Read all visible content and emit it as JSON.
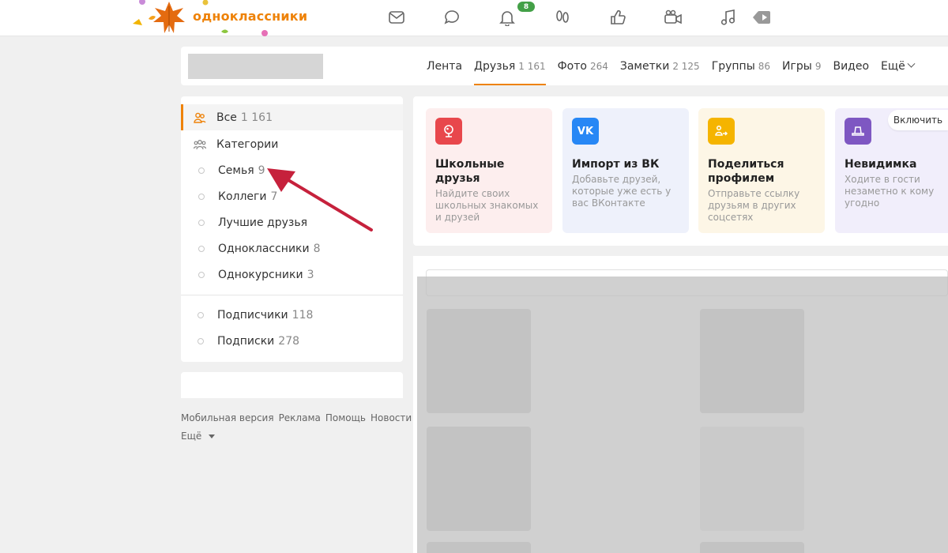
{
  "header": {
    "logo_text": "одноклассники",
    "notifications_count": "8",
    "icons": [
      "messages-icon",
      "discussions-icon",
      "notifications-icon",
      "guests-icon",
      "likes-icon",
      "video-icon",
      "music-icon",
      "tv-icon"
    ]
  },
  "profile_tabs": [
    {
      "label": "Лента",
      "count": ""
    },
    {
      "label": "Друзья",
      "count": "1 161",
      "active": true
    },
    {
      "label": "Фото",
      "count": "264"
    },
    {
      "label": "Заметки",
      "count": "2 125"
    },
    {
      "label": "Группы",
      "count": "86"
    },
    {
      "label": "Игры",
      "count": "9"
    },
    {
      "label": "Видео",
      "count": ""
    },
    {
      "label": "Ещё",
      "count": ""
    }
  ],
  "left_menu": {
    "all": {
      "label": "Все",
      "count": "1 161"
    },
    "categories": {
      "label": "Категории"
    },
    "items": [
      {
        "label": "Семья",
        "count": "9"
      },
      {
        "label": "Коллеги",
        "count": "7"
      },
      {
        "label": "Лучшие друзья",
        "count": ""
      },
      {
        "label": "Одноклассники",
        "count": "8"
      },
      {
        "label": "Однокурсники",
        "count": "3"
      }
    ],
    "subscribers": {
      "label": "Подписчики",
      "count": "118"
    },
    "subscriptions": {
      "label": "Подписки",
      "count": "278"
    }
  },
  "footer": {
    "links": [
      "Мобильная версия",
      "Реклама",
      "Помощь",
      "Новости"
    ],
    "more": "Ещё"
  },
  "cards": [
    {
      "title": "Школьные друзья",
      "desc": "Найдите своих школьных знакомых и друзей",
      "bg": "#fdeeee",
      "icon_bg": "#e8474c",
      "icon": "school-icon"
    },
    {
      "title": "Импорт из ВК",
      "desc": "Добавьте друзей, которые уже есть у вас ВКонтакте",
      "bg": "#eef1fb",
      "icon_bg": "#2787f5",
      "icon": "vk-icon"
    },
    {
      "title": "Поделиться профилем",
      "desc": "Отправьте ссылку друзьям в других соцсетях",
      "bg": "#fdf6e6",
      "icon_bg": "#f5b400",
      "icon": "share-icon"
    },
    {
      "title": "Невидимка",
      "desc": "Ходите в гости незаметно к кому угодно",
      "bg": "#f1eefb",
      "icon_bg": "#7e57c2",
      "icon": "invisible-icon"
    }
  ],
  "enable_button": "Включить",
  "colors": {
    "accent": "#ee8208",
    "badge": "#43a047",
    "arrow": "#c6213c"
  }
}
